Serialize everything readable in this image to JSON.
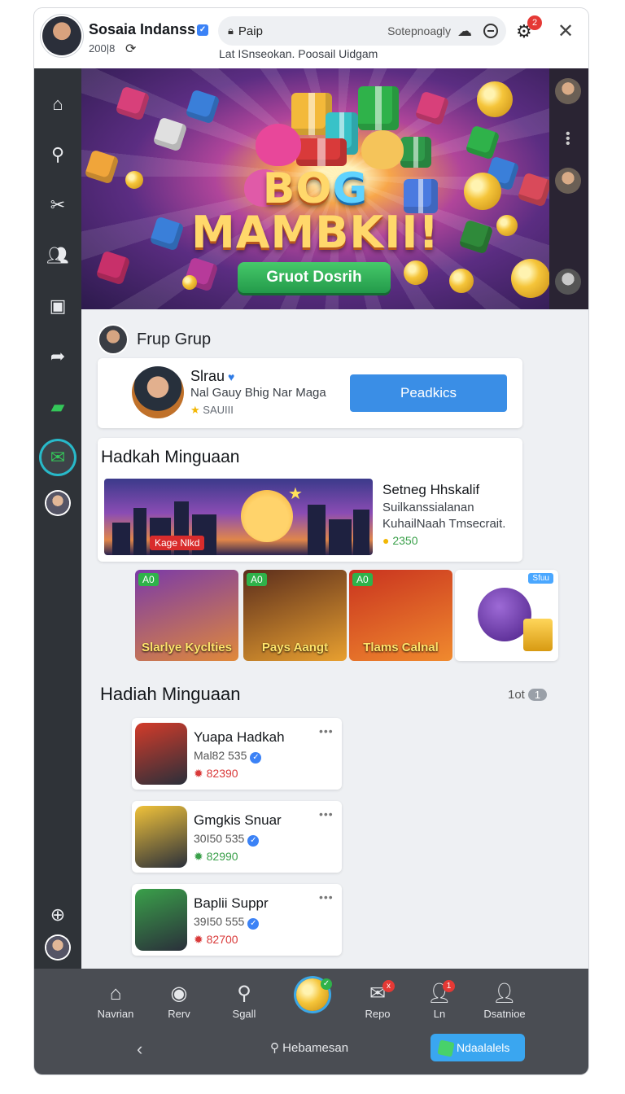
{
  "header": {
    "profile_name": "Sosaia Indanss",
    "profile_sub": "200|8",
    "search_text": "Paip",
    "search_right": "Sotepnoagly",
    "caption": "Lat ISnseokan.  Poosail Uidgam",
    "notification_count": "2"
  },
  "rail": {
    "items": [
      "home-icon",
      "search-icon",
      "fork-icon",
      "users-icon",
      "camera-icon",
      "share-icon",
      "cash-icon",
      "inbox-icon",
      "avatar"
    ]
  },
  "banner": {
    "title_line1_a": "BO",
    "title_line1_b": "G",
    "title_line2": "MAMBKII!",
    "button_label": "Gruot Dosrih"
  },
  "group": {
    "title": "Frup Grup",
    "featured": {
      "name": "Slrau",
      "description": "Nal Gauy Bhig Nar Maga",
      "meta": "SAUIII",
      "button_label": "Peadkics"
    }
  },
  "weekly": {
    "title": "Hadkah Minguaan",
    "sticker": "Kage Nlkd",
    "tile_title": "Setneg Hhskalif",
    "tile_desc": "Suilkanssialanan KuhailNaah Tmsecrait.",
    "tile_coins": "2350",
    "thumbs": [
      {
        "badge": "A0",
        "label": "Slarlye Kyclties",
        "colors": [
          "#7a3aa8",
          "#e0893a"
        ]
      },
      {
        "badge": "A0",
        "label": "Pays Aangt",
        "colors": [
          "#5b2d1c",
          "#e8a030"
        ]
      },
      {
        "badge": "A0",
        "label": "Tlams Calnal",
        "colors": [
          "#c9331f",
          "#f08a2e"
        ]
      },
      {
        "badge": "Sfuu",
        "label": "",
        "colors": [
          "#f3f3f6",
          "#ffffff"
        ]
      }
    ]
  },
  "rewards": {
    "title": "Hadiah Minguaan",
    "page_text": "1ot",
    "page_pill": "1",
    "items": [
      {
        "title": "Yuapa Hadkah",
        "sub": "Mal82 535",
        "coins": "82390",
        "coin_color": "#d93a3a",
        "bg": [
          "#d33b2a",
          "#2a2f3a"
        ]
      },
      {
        "title": "Gmgkis Snuar",
        "sub": "30I50 535",
        "coins": "82990",
        "coin_color": "#3aa04a",
        "bg": [
          "#f0c23a",
          "#2a2f3a"
        ]
      },
      {
        "title": "Baplii Suppr",
        "sub": "39I50 555",
        "coins": "82700",
        "coin_color": "#d93a3a",
        "bg": [
          "#3aa04a",
          "#2a2f3a"
        ]
      }
    ]
  },
  "bottom_nav": {
    "items": [
      {
        "label": "Navrian",
        "icon": "house-icon"
      },
      {
        "label": "Rerv",
        "icon": "target-icon"
      },
      {
        "label": "Sgall",
        "icon": "search-icon"
      },
      {
        "label": "",
        "icon": "coin-icon"
      },
      {
        "label": "Repo",
        "icon": "mail-icon"
      },
      {
        "label": "Ln",
        "icon": "user-icon"
      },
      {
        "label": "Dsatnioe",
        "icon": "person-icon"
      }
    ],
    "mail_badge": "x",
    "user_badge": "1",
    "search_label": "Hebamesan",
    "action_label": "Ndaalalels"
  }
}
